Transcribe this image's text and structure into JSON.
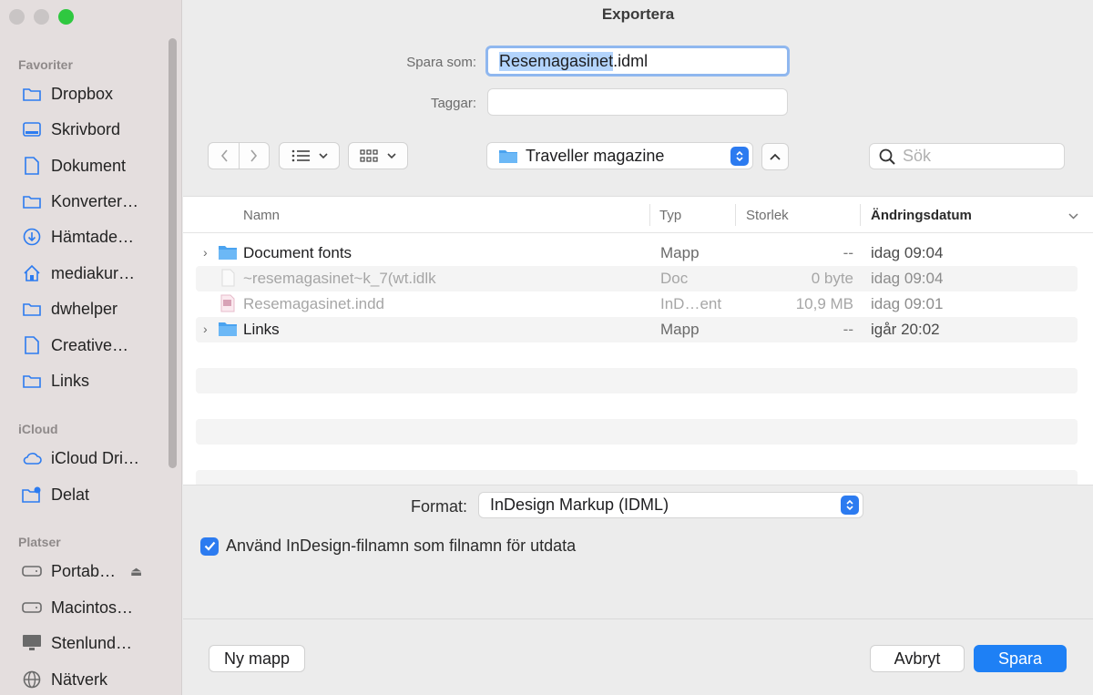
{
  "window": {
    "title": "Exportera"
  },
  "sidebar": {
    "sections": [
      {
        "label": "Favoriter"
      },
      {
        "label": "iCloud"
      },
      {
        "label": "Platser"
      }
    ],
    "favorites": [
      {
        "label": "Dropbox",
        "icon": "folder-icon"
      },
      {
        "label": "Skrivbord",
        "icon": "desktop-icon"
      },
      {
        "label": "Dokument",
        "icon": "document-icon"
      },
      {
        "label": "Konverter…",
        "icon": "folder-icon"
      },
      {
        "label": "Hämtade…",
        "icon": "download-icon"
      },
      {
        "label": "mediakur…",
        "icon": "home-icon"
      },
      {
        "label": "dwhelper",
        "icon": "folder-icon"
      },
      {
        "label": "Creative…",
        "icon": "file-icon"
      },
      {
        "label": "Links",
        "icon": "folder-icon"
      }
    ],
    "icloud": [
      {
        "label": "iCloud Dri…",
        "icon": "cloud-icon"
      },
      {
        "label": "Delat",
        "icon": "shared-folder-icon"
      }
    ],
    "places": [
      {
        "label": "Portab…",
        "icon": "drive-icon"
      },
      {
        "label": "Macintos…",
        "icon": "drive-icon"
      },
      {
        "label": "Stenlund…",
        "icon": "monitor-icon"
      },
      {
        "label": "Nätverk",
        "icon": "globe-icon"
      }
    ]
  },
  "form": {
    "save_as_label": "Spara som:",
    "filename_selected": "Resemagasinet",
    "filename_ext": ".idml",
    "tags_label": "Taggar:",
    "tags_value": ""
  },
  "toolbar": {
    "location": "Traveller magazine",
    "search_placeholder": "Sök"
  },
  "columns": {
    "name": "Namn",
    "kind": "Typ",
    "size": "Storlek",
    "date": "Ändringsdatum"
  },
  "files": [
    {
      "name": "Document fonts",
      "kind": "Mapp",
      "size": "--",
      "date": "idag 09:04",
      "type": "folder",
      "dim": false
    },
    {
      "name": "~resemagasinet~k_7(wt.idlk",
      "kind": "Doc",
      "size": "0 byte",
      "date": "idag 09:04",
      "type": "doc",
      "dim": true
    },
    {
      "name": "Resemagasinet.indd",
      "kind": "InD…ent",
      "size": "10,9 MB",
      "date": "idag 09:01",
      "type": "indd",
      "dim": true
    },
    {
      "name": "Links",
      "kind": "Mapp",
      "size": "--",
      "date": "igår 20:02",
      "type": "folder",
      "dim": false
    }
  ],
  "format": {
    "label": "Format:",
    "value": "InDesign Markup (IDML)"
  },
  "options": {
    "use_filename_label": "Använd InDesign-filnamn som filnamn för utdata",
    "use_filename_checked": true
  },
  "buttons": {
    "new_folder": "Ny mapp",
    "cancel": "Avbryt",
    "save": "Spara"
  },
  "colors": {
    "accent": "#1e80f5",
    "folder": "#4aa3f0"
  }
}
